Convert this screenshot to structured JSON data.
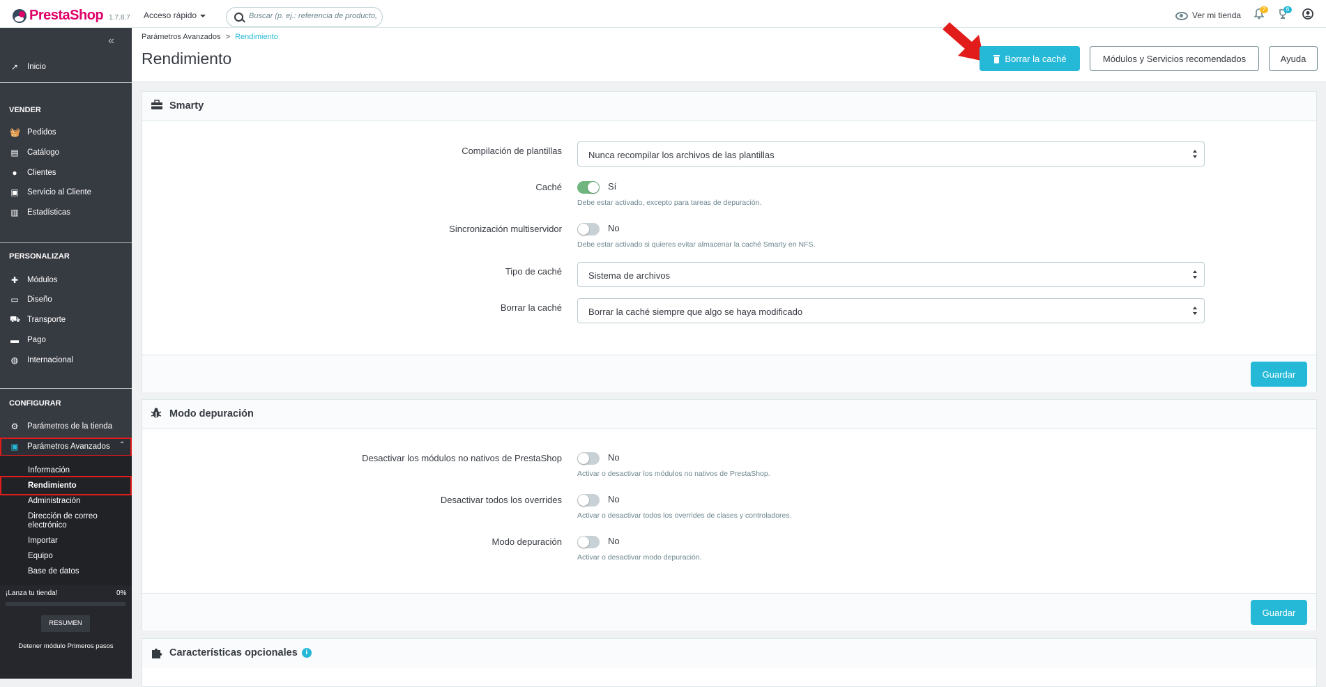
{
  "topbar": {
    "logo_text": "PrestaShop",
    "version": "1.7.8.7",
    "quick_access": "Acceso rápido",
    "search_placeholder": "Buscar (p. ej.: referencia de producto,",
    "view_store": "Ver mi tienda",
    "notifications_count": "7",
    "trophy_count": "6"
  },
  "sidebar": {
    "home": "Inicio",
    "sections": {
      "sell": "VENDER",
      "customize": "PERSONALIZAR",
      "configure": "CONFIGURAR"
    },
    "sell_items": [
      "Pedidos",
      "Catálogo",
      "Clientes",
      "Servicio al Cliente",
      "Estadísticas"
    ],
    "customize_items": [
      "Módulos",
      "Diseño",
      "Transporte",
      "Pago",
      "Internacional"
    ],
    "configure_items": [
      "Parámetros de la tienda",
      "Parámetros Avanzados"
    ],
    "advanced_subitems": [
      "Información",
      "Rendimiento",
      "Administración",
      "Dirección de correo",
      "electrónico",
      "Importar",
      "Equipo",
      "Base de datos"
    ],
    "launch_text": "¡Lanza tu tienda!",
    "launch_percent": "0%",
    "launch_progress": 0,
    "summary_button": "RESUMEN",
    "stop_module": "Detener módulo Primeros pasos"
  },
  "header": {
    "breadcrumb_parent": "Parámetros Avanzados",
    "breadcrumb_sep": ">",
    "breadcrumb_current": "Rendimiento",
    "title": "Rendimiento",
    "clear_cache": "Borrar la caché",
    "recommended": "Módulos y Servicios recomendados",
    "help": "Ayuda"
  },
  "smarty": {
    "title": "Smarty",
    "compile_label": "Compilación de plantillas",
    "compile_value": "Nunca recompilar los archivos de las plantillas",
    "cache_label": "Caché",
    "cache_state": "Sí",
    "cache_help": "Debe estar activado, excepto para tareas de depuración.",
    "multiserver_label": "Sincronización multiservidor",
    "multiserver_state": "No",
    "multiserver_help": "Debe estar activado si quieres evitar almacenar la caché Smarty en NFS.",
    "cache_type_label": "Tipo de caché",
    "cache_type_value": "Sistema de archivos",
    "clear_label": "Borrar la caché",
    "clear_value": "Borrar la caché siempre que algo se haya modificado",
    "save": "Guardar"
  },
  "debug": {
    "title": "Modo depuración",
    "nonnative_label": "Desactivar los módulos no nativos de PrestaShop",
    "nonnative_state": "No",
    "nonnative_help": "Activar o desactivar los módulos no nativos de PrestaShop.",
    "overrides_label": "Desactivar todos los overrides",
    "overrides_state": "No",
    "overrides_help": "Activar o desactivar todos los overrides de clases y controladores.",
    "debug_label": "Modo depuración",
    "debug_state": "No",
    "debug_help": "Activar o desactivar modo depuración.",
    "save": "Guardar"
  },
  "optional": {
    "title": "Características opcionales",
    "info_icon": "i"
  },
  "colors": {
    "accent": "#25b9d7",
    "brand": "#df0067",
    "sidebar": "#363a41",
    "highlight": "#e21b1b",
    "toggle_on": "#70b580"
  }
}
